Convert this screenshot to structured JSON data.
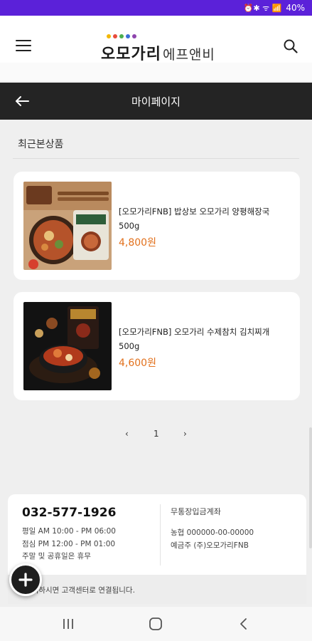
{
  "status_bar": {
    "icons": "⏰✱ ᯤ 📶",
    "battery": "40%"
  },
  "header": {
    "menu_icon": "hamburger-menu-icon",
    "logo_main": "오모가리",
    "logo_sub": "에프앤비",
    "search_icon": "search-icon",
    "logo_dot_colors": [
      "#f2b705",
      "#e84b3c",
      "#4caf50",
      "#3b6fd8",
      "#8e44ad"
    ]
  },
  "page": {
    "back_icon": "arrow-left-icon",
    "title": "마이페이지"
  },
  "recent": {
    "label": "최근본상품",
    "products": [
      {
        "name": "[오모가리FNB] 밥상보 오모가리 양평해장국 500g",
        "price": "4,800원"
      },
      {
        "name": "[오모가리FNB] 오모가리 수제참치 김치찌개 500g",
        "price": "4,600원"
      }
    ]
  },
  "pager": {
    "prev": "‹",
    "current": "1",
    "next": "›"
  },
  "footer": {
    "phone": "032-577-1926",
    "hours": [
      "평일 AM 10:00 - PM 06:00",
      "점심 PM 12:00 - PM 01:00",
      "주말 및 공휴일은 휴무"
    ],
    "bank_title": "무통장입금계좌",
    "bank": [
      "농협 000000-00-00000",
      "예금주 (주)오모가리FNB"
    ],
    "bottom_text": "터치하시면 고객센터로 연결됩니다."
  },
  "fab_icon": "plus-icon",
  "navbar": {
    "recent_icon": "recent-apps-icon",
    "home_icon": "home-icon",
    "back_icon": "back-icon"
  },
  "colors": {
    "status_bar": "#5b21d9",
    "title_bar": "#242424",
    "price": "#e2711d"
  }
}
